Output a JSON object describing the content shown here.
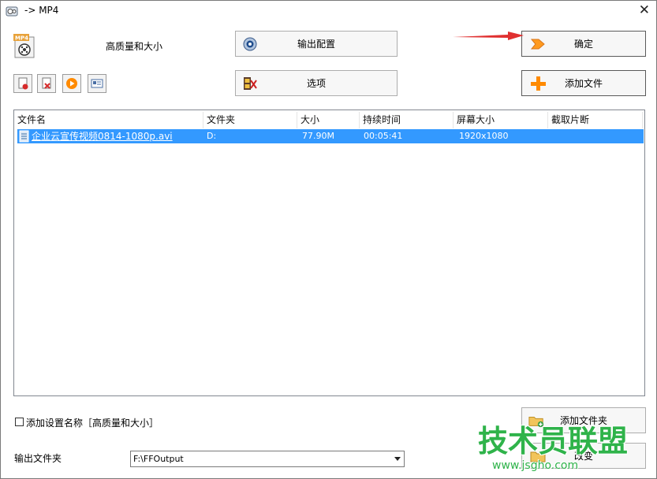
{
  "window": {
    "title": "-> MP4",
    "close_glyph": "✕"
  },
  "profile": {
    "format_badge": "MP4",
    "name": "高质量和大小"
  },
  "buttons": {
    "output_config": "输出配置",
    "ok": "确定",
    "options": "选项",
    "add_file": "添加文件",
    "add_folder": "添加文件夹",
    "change": "改变"
  },
  "toolbar_icons": [
    "remove-file-icon",
    "clear-list-icon",
    "play-icon",
    "media-info-icon"
  ],
  "table": {
    "columns": [
      "文件名",
      "文件夹",
      "大小",
      "持续时间",
      "屏幕大小",
      "截取片断"
    ],
    "rows": [
      {
        "filename": "企业云宣传视频0814-1080p.avi",
        "folder": "D:",
        "size": "77.90M",
        "duration": "00:05:41",
        "screen_size": "1920x1080",
        "clip": ""
      }
    ]
  },
  "add_setting_name": {
    "label": "添加设置名称［高质量和大小］",
    "checked": false
  },
  "output_folder": {
    "label": "输出文件夹",
    "value": "F:\\FFOutput"
  },
  "watermark": {
    "brand": "技术员联盟",
    "url": "www.jsgho.com"
  },
  "colors": {
    "selection": "#3399ff",
    "accent_orange": "#ff8a00",
    "watermark_green": "#2fb34a",
    "arrow_red": "#e03030"
  }
}
